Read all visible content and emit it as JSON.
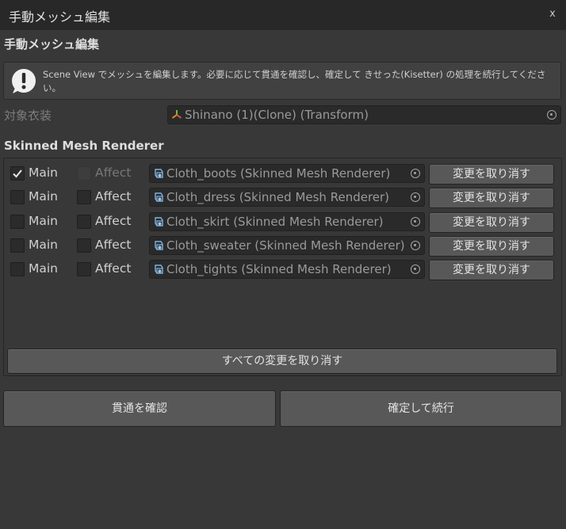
{
  "window": {
    "title": "手動メッシュ編集",
    "close_glyph": "x"
  },
  "header": {
    "title": "手動メッシュ編集"
  },
  "help": {
    "icon": "warning-exclamation-icon",
    "message": "Scene View でメッシュを編集します。必要に応じて貫通を確認し、確定して きせった(Kisetter) の処理を続行してください。"
  },
  "target": {
    "label": "対象衣装",
    "value": "Shinano (1)(Clone) (Transform)",
    "icon": "transform-axes-icon"
  },
  "renderers": {
    "title": "Skinned Mesh Renderer",
    "main_label": "Main",
    "affect_label": "Affect",
    "revert_label": "変更を取り消す",
    "icon": "skinned-mesh-renderer-icon",
    "items": [
      {
        "value": "Cloth_boots (Skinned Mesh Renderer)",
        "main": true,
        "affect": false,
        "affect_enabled": false
      },
      {
        "value": "Cloth_dress (Skinned Mesh Renderer)",
        "main": false,
        "affect": false,
        "affect_enabled": true
      },
      {
        "value": "Cloth_skirt (Skinned Mesh Renderer)",
        "main": false,
        "affect": false,
        "affect_enabled": true
      },
      {
        "value": "Cloth_sweater (Skinned Mesh Renderer)",
        "main": false,
        "affect": false,
        "affect_enabled": true
      },
      {
        "value": "Cloth_tights (Skinned Mesh Renderer)",
        "main": false,
        "affect": false,
        "affect_enabled": true
      }
    ],
    "revert_all_label": "すべての変更を取り消す"
  },
  "actions": {
    "check_penetration_label": "貫通を確認",
    "confirm_continue_label": "確定して続行"
  },
  "colors": {
    "background": "#383838",
    "titlebar": "#282828",
    "field_background": "#2a2a2a",
    "button": "#585858"
  }
}
